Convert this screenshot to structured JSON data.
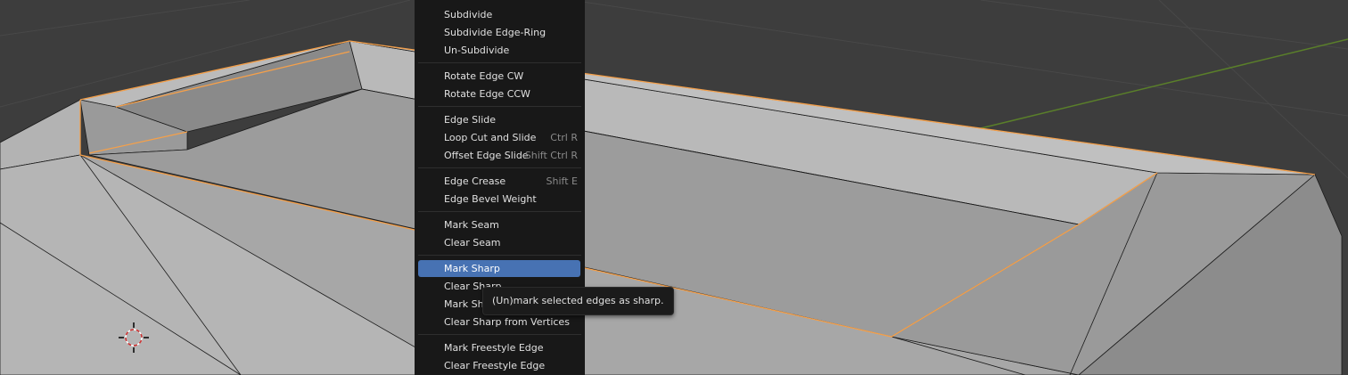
{
  "menu": {
    "items": [
      {
        "label": "Subdivide",
        "shortcut": ""
      },
      {
        "label": "Subdivide Edge-Ring",
        "shortcut": ""
      },
      {
        "label": "Un-Subdivide",
        "shortcut": ""
      },
      {
        "label": "Rotate Edge CW",
        "shortcut": ""
      },
      {
        "label": "Rotate Edge CCW",
        "shortcut": ""
      },
      {
        "label": "Edge Slide",
        "shortcut": ""
      },
      {
        "label": "Loop Cut and Slide",
        "shortcut": "Ctrl R"
      },
      {
        "label": "Offset Edge Slide",
        "shortcut": "Shift Ctrl R"
      },
      {
        "label": "Edge Crease",
        "shortcut": "Shift E"
      },
      {
        "label": "Edge Bevel Weight",
        "shortcut": ""
      },
      {
        "label": "Mark Seam",
        "shortcut": ""
      },
      {
        "label": "Clear Seam",
        "shortcut": ""
      },
      {
        "label": "Mark Sharp",
        "shortcut": "",
        "active": true
      },
      {
        "label": "Clear Sharp",
        "shortcut": ""
      },
      {
        "label": "Mark Sharp from Vertices",
        "shortcut": ""
      },
      {
        "label": "Clear Sharp from Vertices",
        "shortcut": ""
      },
      {
        "label": "Mark Freestyle Edge",
        "shortcut": ""
      },
      {
        "label": "Clear Freestyle Edge",
        "shortcut": ""
      }
    ]
  },
  "tooltip": {
    "text": "(Un)mark selected edges as sharp."
  },
  "colors": {
    "viewport_bg": "#3d3d3d",
    "menu_bg": "#181818",
    "menu_highlight": "#4772b3",
    "selected_edge": "#f5a04a",
    "mesh_face": "#9c9c9c",
    "x_axis": "#8b3a3a",
    "y_axis": "#5a7f2a"
  },
  "icons": [
    "3d-cursor-icon"
  ]
}
